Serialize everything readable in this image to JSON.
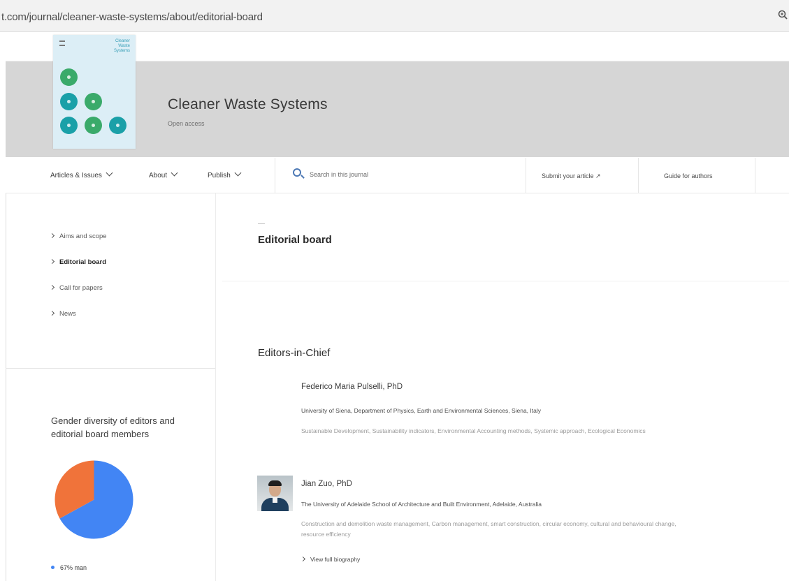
{
  "browser": {
    "url": "t.com/journal/cleaner-waste-systems/about/editorial-board",
    "zoom_icon": "zoom-icon"
  },
  "journal": {
    "cover": {
      "title_lines": [
        "Cleaner",
        "Waste",
        "Systems"
      ],
      "dot_colors": [
        "#3aaa6a",
        "#1aa0a8",
        "#3aaa6a",
        "#1aa0a8",
        "#3aaa6a",
        "#1aa0a8"
      ]
    },
    "title": "Cleaner Waste Systems",
    "subtitle": "Open access"
  },
  "nav": {
    "articles_label": "Articles & Issues",
    "about_label": "About",
    "publish_label": "Publish",
    "search_placeholder": "Search in this journal",
    "submit_label": "Submit your article ↗",
    "guide_label": "Guide for authors"
  },
  "sidebar": {
    "items": [
      {
        "label": "Aims and scope",
        "active": false
      },
      {
        "label": "Editorial board",
        "active": true
      },
      {
        "label": "Call for papers",
        "active": false
      },
      {
        "label": "News",
        "active": false
      }
    ],
    "gender_title": "Gender diversity of editors and editorial board members",
    "legend_label": "67% man"
  },
  "chart_data": {
    "type": "pie",
    "slices": [
      {
        "label": "man",
        "value": 67,
        "color": "#4285f4"
      },
      {
        "label": "",
        "value": 33,
        "color": "#f0733a"
      }
    ]
  },
  "main": {
    "page_title": "Editorial board",
    "section_title": "Editors-in-Chief",
    "editors": [
      {
        "name": "Federico Maria Pulselli, PhD",
        "affiliation": "University of Siena, Department of Physics, Earth and Environmental Sciences, Siena, Italy",
        "keywords": "Sustainable Development, Sustainability indicators, Environmental Accounting methods, Systemic approach, Ecological Economics",
        "has_photo": false
      },
      {
        "name": "Jian Zuo, PhD",
        "affiliation": "The University of Adelaide School of Architecture and Built Environment, Adelaide, Australia",
        "keywords": "Construction and demolition waste management, Carbon management, smart construction, circular economy, cultural and behavioural change, resource efficiency",
        "has_photo": true,
        "bio_link": "View full biography"
      }
    ]
  }
}
